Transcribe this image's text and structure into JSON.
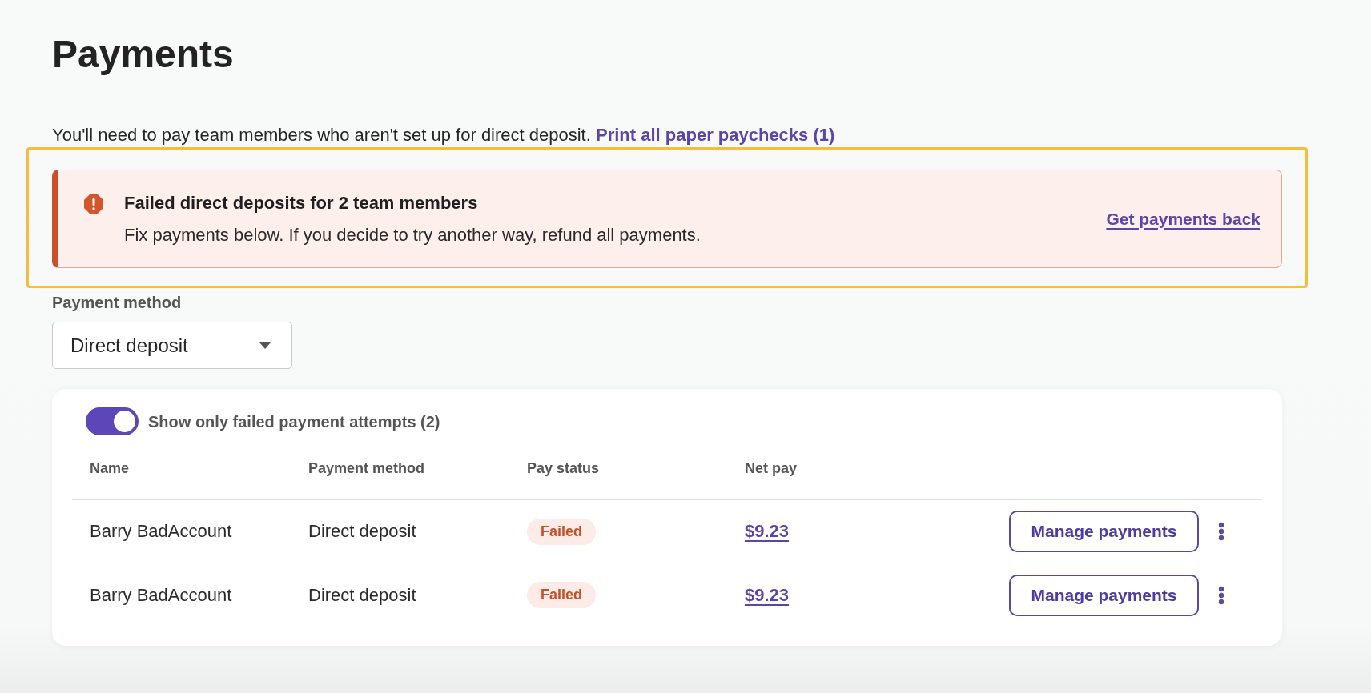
{
  "page": {
    "title": "Payments"
  },
  "notice": {
    "text": "You'll need to pay team members who aren't set up for direct deposit.",
    "link": "Print all paper paychecks (1)"
  },
  "alert": {
    "title": "Failed direct deposits for 2 team members",
    "message": "Fix payments below. If you decide to try another way, refund all payments.",
    "action": "Get payments back"
  },
  "payment_method": {
    "label": "Payment method",
    "value": "Direct deposit"
  },
  "filter_toggle": {
    "label": "Show only failed payment attempts (2)",
    "on": true
  },
  "table": {
    "columns": [
      "Name",
      "Payment method",
      "Pay status",
      "Net pay"
    ],
    "rows": [
      {
        "name": "Barry BadAccount",
        "payment_method": "Direct deposit",
        "pay_status": "Failed",
        "net_pay": "$9.23",
        "action": "Manage payments"
      },
      {
        "name": "Barry BadAccount",
        "payment_method": "Direct deposit",
        "pay_status": "Failed",
        "net_pay": "$9.23",
        "action": "Manage payments"
      }
    ]
  }
}
